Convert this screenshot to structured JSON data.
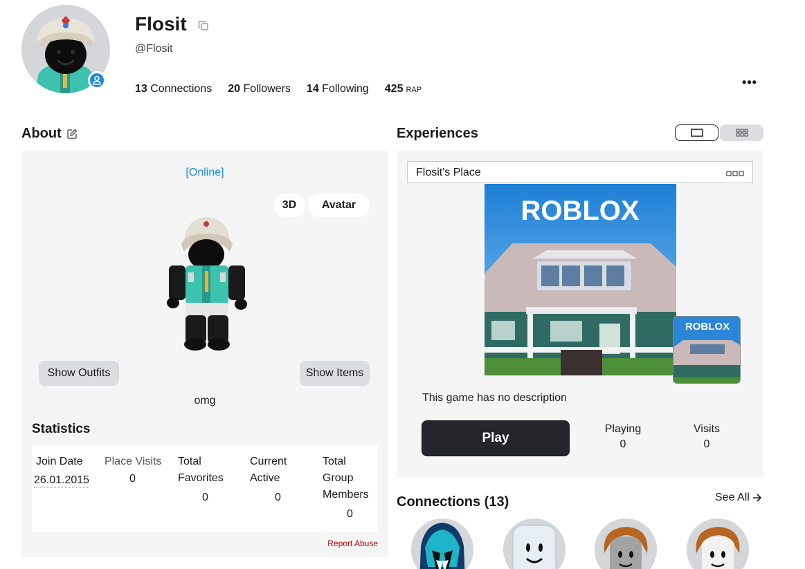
{
  "profile": {
    "display_name": "Flosit",
    "username": "@Flosit",
    "stats": {
      "connections_count": "13",
      "connections_label": "Connections",
      "followers_count": "20",
      "followers_label": "Followers",
      "following_count": "14",
      "following_label": "Following",
      "rap_value": "425",
      "rap_label": "RAP"
    },
    "more_label": "•••"
  },
  "about": {
    "title": "About",
    "status": "[Online]",
    "btn_3d": "3D",
    "btn_avatar": "Avatar",
    "show_outfits": "Show Outfits",
    "show_items": "Show Items",
    "bio": "omg",
    "statistics_title": "Statistics",
    "statistics": {
      "join_date_label": "Join Date",
      "join_date_value": "26.01.2015",
      "place_visits_label": "Place Visits",
      "place_visits_value": "0",
      "total_favorites_label_1": "Total",
      "total_favorites_label_2": "Favorites",
      "total_favorites_value": "0",
      "current_active_label_1": "Current",
      "current_active_label_2": "Active",
      "current_active_value": "0",
      "group_members_label_1": "Total",
      "group_members_label_2": "Group",
      "group_members_label_3": "Members",
      "group_members_value": "0"
    },
    "report_abuse": "Report Abuse"
  },
  "experiences": {
    "title": "Experiences",
    "game_name": "Flosit's Place",
    "thumbnail_logo": "ROBLOX",
    "description": "This game has no description",
    "play_label": "Play",
    "playing_label": "Playing",
    "playing_value": "0",
    "visits_label": "Visits",
    "visits_value": "0"
  },
  "connections": {
    "title": "Connections (13)",
    "see_all": "See All"
  },
  "colors": {
    "accent_blue": "#1e88e5",
    "play_button": "#24262b",
    "report_red": "#c00000",
    "panel_bg": "#f5f5f5"
  }
}
